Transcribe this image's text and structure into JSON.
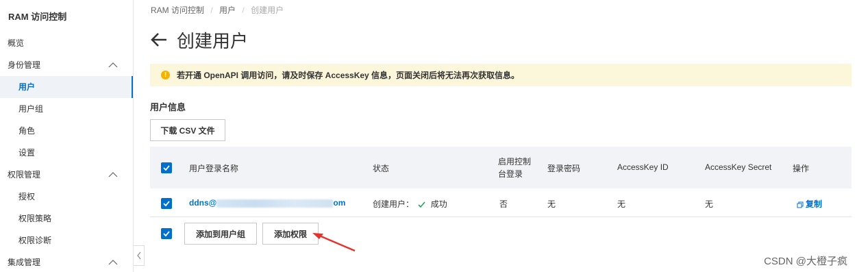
{
  "sidebar": {
    "title": "RAM 访问控制",
    "items": [
      {
        "label": "概览"
      },
      {
        "label": "身份管理"
      },
      {
        "label": "用户"
      },
      {
        "label": "用户组"
      },
      {
        "label": "角色"
      },
      {
        "label": "设置"
      },
      {
        "label": "权限管理"
      },
      {
        "label": "授权"
      },
      {
        "label": "权限策略"
      },
      {
        "label": "权限诊断"
      },
      {
        "label": "集成管理"
      }
    ]
  },
  "breadcrumb": {
    "items": [
      "RAM 访问控制",
      "用户",
      "创建用户"
    ],
    "sep": "/"
  },
  "page": {
    "title": "创建用户"
  },
  "alert": {
    "text": "若开通 OpenAPI 调用访问，请及时保存 AccessKey 信息，页面关闭后将无法再次获取信息。",
    "icon": "!"
  },
  "user_info": {
    "title": "用户信息",
    "download_label": "下载 CSV 文件",
    "columns": [
      "用户登录名称",
      "状态",
      "启用控制台登录",
      "登录密码",
      "AccessKey ID",
      "AccessKey Secret",
      "操作"
    ],
    "row": {
      "login_name_prefix": "ddns@",
      "login_name_suffix": "om",
      "status_prefix": "创建用户：",
      "status_value": "成功",
      "console_login": "否",
      "password": "无",
      "ak_id": "无",
      "ak_secret": "无",
      "action": "复制"
    },
    "add_group_label": "添加到用户组",
    "add_permission_label": "添加权限"
  },
  "watermark": "CSDN @大橙子疯",
  "colors": {
    "accent": "#0070cc",
    "alert_bg": "#fcf6db",
    "arrow": "#e8312a"
  }
}
